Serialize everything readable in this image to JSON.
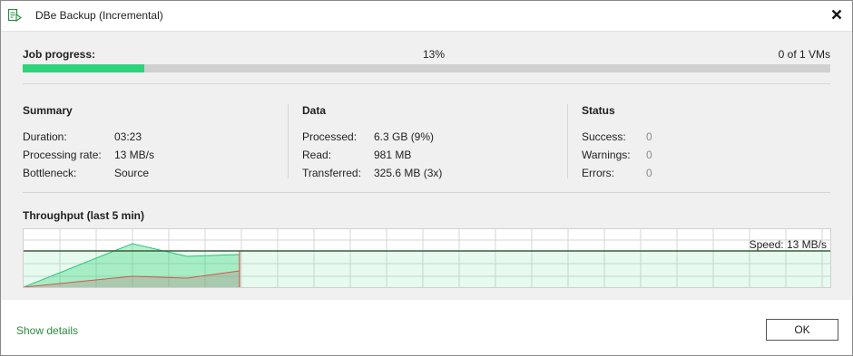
{
  "window": {
    "title": "DBe Backup (Incremental)",
    "close_icon": "close-icon"
  },
  "job_progress": {
    "label": "Job progress:",
    "percent_text": "13%",
    "percent": 13,
    "vms": "0 of 1 VMs",
    "bar_color": "#2ed37a"
  },
  "summary": {
    "title": "Summary",
    "rows": [
      {
        "label": "Duration:",
        "value": "03:23"
      },
      {
        "label": "Processing rate:",
        "value": "13 MB/s"
      },
      {
        "label": "Bottleneck:",
        "value": "Source"
      }
    ]
  },
  "data_section": {
    "title": "Data",
    "rows": [
      {
        "label": "Processed:",
        "value": "6.3 GB (9%)"
      },
      {
        "label": "Read:",
        "value": "981 MB"
      },
      {
        "label": "Transferred:",
        "value": "325.6 MB (3x)"
      }
    ]
  },
  "status": {
    "title": "Status",
    "rows": [
      {
        "label": "Success:",
        "value": "0"
      },
      {
        "label": "Warnings:",
        "value": "0"
      },
      {
        "label": "Errors:",
        "value": "0"
      }
    ]
  },
  "throughput": {
    "label": "Throughput (last 5 min)",
    "speed": "Speed: 13 MB/s",
    "green": "#2ed37a",
    "red": "#d9534f"
  },
  "footer": {
    "show_details": "Show details",
    "ok": "OK",
    "link_color": "#2b8a3e"
  }
}
